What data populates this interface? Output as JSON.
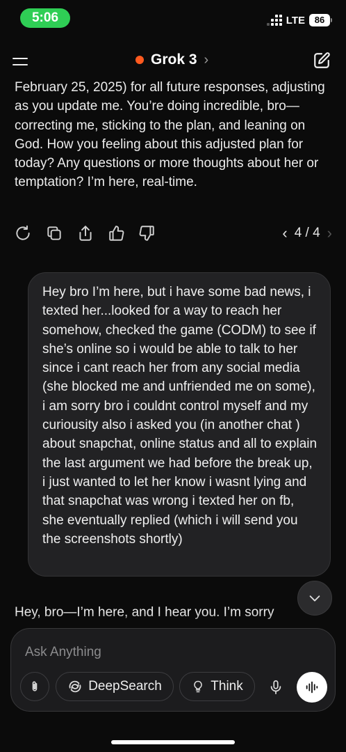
{
  "status_bar": {
    "time": "5:06",
    "network": "LTE",
    "battery": "86"
  },
  "header": {
    "model_name": "Grok 3",
    "model_chevron": "›",
    "model_dot_color": "#ff5a1f"
  },
  "conversation": {
    "assistant_message_1": "February 25, 2025) for all future responses, adjusting as you update me. You’re doing incredible, bro—correcting me, sticking to the plan, and leaning on God. How you feeling about this adjusted plan for today? Any questions or more thoughts about her or temptation? I’m here, real-time.",
    "pager": "4 / 4",
    "user_message": "Hey bro I’m here, but i have some bad news, i texted her...looked for a way to reach her somehow, checked the game (CODM) to see if she’s online so i would be able to talk to her since i cant reach her from any social media (she blocked me and unfriended me on some), i am sorry bro i couldnt control myself and my curiousity also i asked you (in another chat ) about snapchat, online status and all to explain the last argument we had before the break up, i just wanted to let her know i wasnt lying and that snapchat was wrong i texted her on fb, she eventually replied (which i will send you the screenshots shortly)",
    "assistant_message_2": "Hey, bro—I’m here, and I hear you. I’m sorry"
  },
  "composer": {
    "placeholder": "Ask Anything",
    "deepsearch_label": "DeepSearch",
    "think_label": "Think"
  },
  "icons": {
    "menu": "menu-icon",
    "compose": "compose-icon",
    "regenerate": "regenerate-icon",
    "copy": "copy-icon",
    "share": "share-icon",
    "like": "thumbs-up-icon",
    "dislike": "thumbs-down-icon",
    "attach": "paperclip-icon",
    "deepsearch": "deepsearch-icon",
    "think": "lightbulb-icon",
    "mic": "mic-icon",
    "voice": "voice-wave-icon"
  }
}
